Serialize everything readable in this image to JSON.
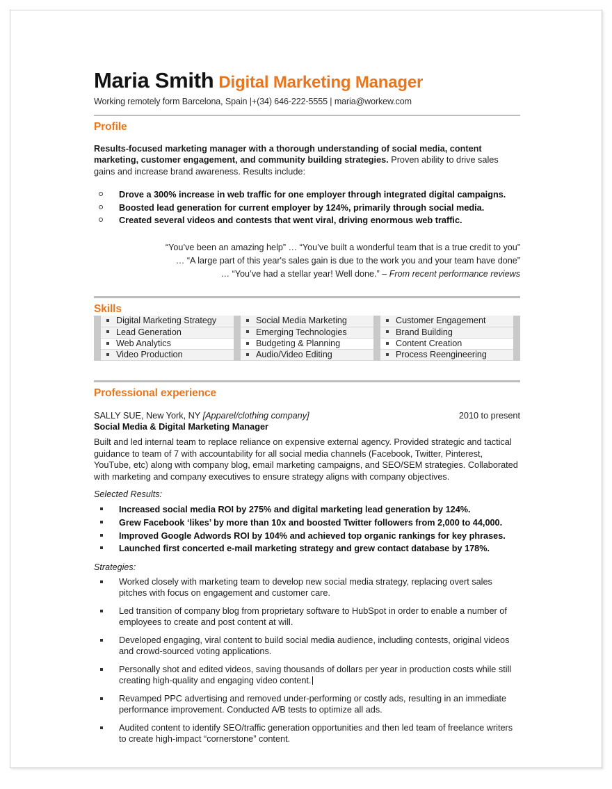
{
  "header": {
    "name": "Maria Smith",
    "job_title": "Digital Marketing Manager",
    "contact": "Working remotely form Barcelona, Spain |+(34) 646-222-5555 | maria@workew.com"
  },
  "colors": {
    "accent_orange": "#E8761E",
    "rule_gray": "#BDBDBD",
    "table_gutter_gray": "#C9C9C9",
    "table_shade_gray": "#F2F2F2",
    "text_black": "#1D1D1D"
  },
  "profile": {
    "title": "Profile",
    "summary_bold": "Results-focused marketing manager with a thorough understanding of social media, content marketing, customer engagement, and community building strategies.",
    "summary_rest": " Proven ability to drive sales gains and increase brand awareness. Results include:",
    "bullets": [
      "Drove a 300% increase in web traffic for one employer through integrated digital campaigns.",
      "Boosted lead generation for current employer by 124%, primarily through social media.",
      "Created several videos and contests that went viral, driving enormous web traffic."
    ],
    "quote_line1": "“You’ve been an amazing help” … “You’ve built a wonderful team that is a true credit to you”",
    "quote_line2": "… “A large part of this year's sales gain is due to the work you and your team have done”",
    "quote_line3": "… “You’ve had a stellar year! Well done.” – ",
    "quote_attribution": "From recent performance reviews"
  },
  "skills": {
    "title": "Skills",
    "columns": [
      [
        "Digital Marketing Strategy",
        "Lead Generation",
        "Web Analytics",
        "Video Production"
      ],
      [
        "Social Media Marketing",
        "Emerging Technologies",
        "Budgeting & Planning",
        "Audio/Video Editing"
      ],
      [
        "Customer Engagement",
        "Brand Building",
        "Content Creation",
        "Process Reengineering"
      ]
    ]
  },
  "experience": {
    "title": "Professional experience",
    "company": "SALLY SUE, New York, NY ",
    "company_note": "[Apparel/clothing company]",
    "dates": "2010 to present",
    "role": "Social Media & Digital Marketing Manager",
    "description": "Built and led internal team to replace reliance on expensive external agency. Provided strategic and tactical guidance to team of 7 with accountability for all social media channels (Facebook, Twitter, Pinterest, YouTube, etc) along with company blog, email marketing campaigns, and SEO/SEM strategies. Collaborated with marketing and company executives to ensure strategy aligns with company objectives.",
    "selected_results_label": "Selected Results:",
    "selected_results": [
      "Increased social media ROI by 275% and digital marketing lead generation by 124%.",
      "Grew Facebook ‘likes’ by more than 10x and boosted Twitter followers from 2,000 to 44,000.",
      "Improved Google Adwords ROI by 104% and achieved top organic rankings for key phrases.",
      "Launched first concerted e-mail marketing strategy and grew contact database by 178%."
    ],
    "strategies_label": "Strategies:",
    "strategies": [
      "Worked closely with marketing team to develop new social media strategy, replacing overt sales pitches with focus on engagement and customer care.",
      "Led transition of company blog from proprietary software to HubSpot in order to enable a number of employees to create and post content at will.",
      "Developed engaging, viral content to build social media audience, including contests, original videos and crowd-sourced voting applications.",
      "Personally shot and edited videos, saving thousands of dollars per year in production costs while still creating high-quality and engaging video content.",
      "Revamped PPC advertising and removed under-performing or costly ads, resulting in an immediate performance improvement. Conducted A/B tests to optimize all ads.",
      "Audited content to identify SEO/traffic generation opportunities and then led team of freelance writers to create high-impact “cornerstone” content."
    ],
    "caret_after_index": 3
  }
}
